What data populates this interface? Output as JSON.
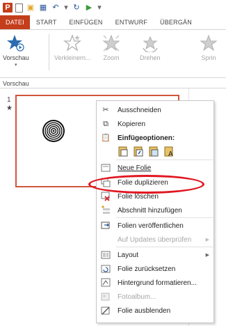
{
  "tabs": [
    "DATEI",
    "START",
    "EINFÜGEN",
    "ENTWURF",
    "ÜBERGÄN"
  ],
  "ribbon": {
    "buttons": [
      {
        "label": "Vorschau",
        "icon": "star-play-icon"
      },
      {
        "label": "Verkleinern...",
        "icon": "shrink-star-icon"
      },
      {
        "label": "Zoom",
        "icon": "zoom-star-icon"
      },
      {
        "label": "Drehen",
        "icon": "spin-star-icon"
      },
      {
        "label": "Sprin",
        "icon": "spring-star-icon"
      }
    ],
    "group_label": "Vorschau"
  },
  "slide_panel": {
    "slide_number": "1",
    "animation_marker": "★"
  },
  "context_menu": {
    "items": [
      {
        "label": "Ausschneiden",
        "icon": "scissors-icon"
      },
      {
        "label": "Kopieren",
        "icon": "copy-icon"
      },
      {
        "label": "Einfügeoptionen:",
        "icon": "paste-options-icon"
      },
      {
        "label": "Neue Folie",
        "icon": "new-slide-icon"
      },
      {
        "label": "Folie duplizieren",
        "icon": "duplicate-slide-icon"
      },
      {
        "label": "Folie löschen",
        "icon": "delete-slide-icon"
      },
      {
        "label": "Abschnitt hinzufügen",
        "icon": "add-section-icon"
      },
      {
        "label": "Folien veröffentlichen",
        "icon": "publish-slides-icon"
      },
      {
        "label": "Auf Updates überprüfen",
        "icon": ""
      },
      {
        "label": "Layout",
        "icon": "layout-icon"
      },
      {
        "label": "Folie zurücksetzen",
        "icon": "reset-slide-icon"
      },
      {
        "label": "Hintergrund formatieren...",
        "icon": "format-background-icon"
      },
      {
        "label": "Fotoalbum...",
        "icon": "photo-album-icon"
      },
      {
        "label": "Folie ausblenden",
        "icon": "hide-slide-icon"
      }
    ]
  },
  "colors": {
    "file_tab": "#c43e1c",
    "selection_border": "#d0563d",
    "annotation": "#e0161f",
    "highlight": "#e5f1fb"
  }
}
